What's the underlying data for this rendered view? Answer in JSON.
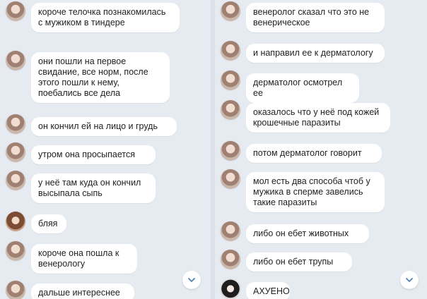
{
  "left_chat": {
    "messages": [
      {
        "text": "короче телочка познакомилась с мужиком в тиндере"
      },
      {
        "text": "они пошли на первое свидание, все норм, после этого пошли к нему, поебались все дела"
      },
      {
        "text": "он кончил ей на лицо и грудь"
      },
      {
        "text": "утром она просыпается"
      },
      {
        "text": "у неё там куда он кончил высыпала сыпь"
      },
      {
        "text": "бляя"
      },
      {
        "text": "короче она пошла к венерологу"
      },
      {
        "text": "дальше интереснее"
      }
    ]
  },
  "right_chat": {
    "messages": [
      {
        "text": "венеролог сказал что это не венерическое"
      },
      {
        "text": "и направил ее к дерматологу"
      },
      {
        "text": "дерматолог осмотрел ее"
      },
      {
        "text": "оказалось что у неё под кожей крошечные паразиты"
      },
      {
        "text": "потом дерматолог говорит"
      },
      {
        "text": "мол есть два способа чтоб у мужика в сперме завелись такие паразиты"
      },
      {
        "text": "либо он ебет животных"
      },
      {
        "text": "либо он ебет трупы"
      },
      {
        "text": "АХУЕНО"
      }
    ]
  },
  "icons": {
    "scroll_down": "chevron-down-icon",
    "accent": "#5181b8"
  }
}
